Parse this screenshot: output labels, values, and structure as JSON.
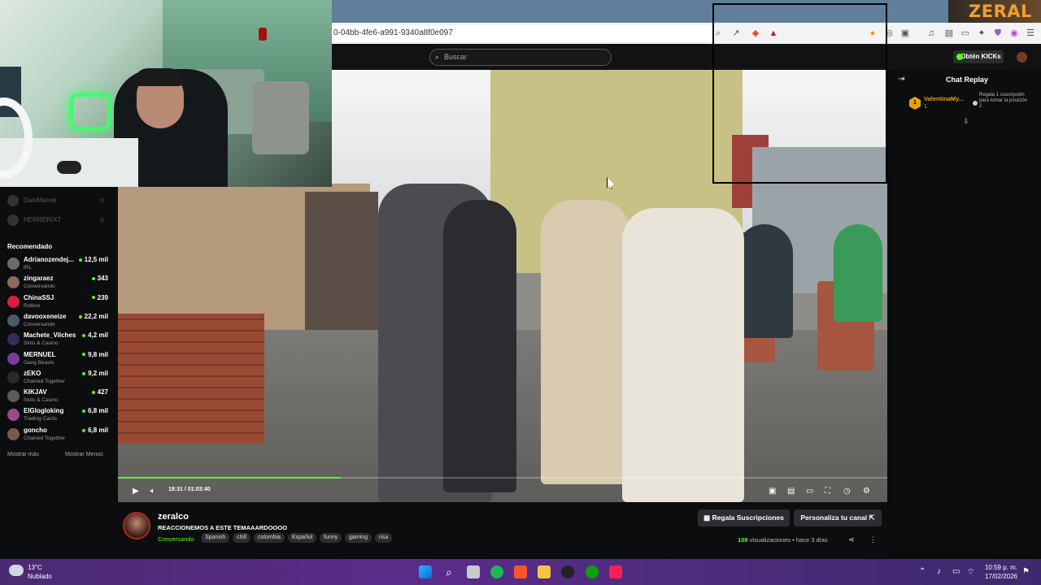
{
  "browser": {
    "url": "0-04bb-4fe6-a991-9340a8f0e097",
    "toolbar_icons": [
      "zoom-icon",
      "share-icon",
      "brave-shield-icon",
      "alert-icon",
      "ext-icon-1",
      "ext-icon-2",
      "ext-icon-3",
      "media-icon",
      "bookmark-icon",
      "tabs-icon",
      "sparkle-icon",
      "vpn-icon",
      "wallet-icon",
      "menu-icon"
    ]
  },
  "overlay": {
    "brand_text": "ZERAL"
  },
  "header": {
    "search_placeholder": "Buscar",
    "kicks_button": "Obtén KICKs"
  },
  "sidebar": {
    "followed": [
      {
        "name": "DaniMarvel"
      },
      {
        "name": "HERRERIX7"
      }
    ],
    "recommended_heading": "Recomendado",
    "recommended": [
      {
        "name": "Adrianozendej...",
        "category": "IRL",
        "viewers": "12,5 mil",
        "color": "#6b6b6b"
      },
      {
        "name": "zingaraez",
        "category": "Conversando",
        "viewers": "343",
        "color": "#8a6a5a"
      },
      {
        "name": "ChinaSSJ",
        "category": "Roblox",
        "viewers": "239",
        "color": "#d8203a"
      },
      {
        "name": "davooxeneize",
        "category": "Conversando",
        "viewers": "22,2 mil",
        "color": "#4a5a6a"
      },
      {
        "name": "Machete_Vilches",
        "category": "Slots & Casino",
        "viewers": "4,2 mil",
        "color": "#3a2a5a"
      },
      {
        "name": "MERNUEL",
        "category": "Gang Beasts",
        "viewers": "9,8 mil",
        "color": "#7a3aa0"
      },
      {
        "name": "zEKO",
        "category": "Chained Together",
        "viewers": "9,2 mil",
        "color": "#2a2a2a"
      },
      {
        "name": "KIKJAV",
        "category": "Slots & Casino",
        "viewers": "427",
        "color": "#5a5a5a"
      },
      {
        "name": "ElGlogloking",
        "category": "Trading Cards",
        "viewers": "6,8 mil",
        "color": "#9a4a8a"
      },
      {
        "name": "goncho",
        "category": "Chained Together",
        "viewers": "6,8 mil",
        "color": "#7a5a4a"
      }
    ],
    "show_more": "Mostrar más",
    "show_less": "Mostrar Menos"
  },
  "player": {
    "time": "18:31 / 01:03:40",
    "progress": 0.29,
    "accent": "#53fc18"
  },
  "chat": {
    "title": "Chat Replay",
    "gift_user": "ValentinaMy...",
    "gift_count": "1",
    "gift_text": "Regala 1 suscripción para tomar la posición 2"
  },
  "stream": {
    "streamer": "zeralco",
    "title": "REACCIONEMOS A ESTE TEMAAARDOOOO",
    "category": "Conversando",
    "tags": [
      "Spanish",
      "chill",
      "colombia",
      "Español",
      "funny",
      "gaming",
      "risa"
    ],
    "gift_subs_button": "Regala Suscripciones",
    "customize_button": "Personaliza tu canal",
    "view_count": "108",
    "views_label": "visualizaciones",
    "ago": "hace 3 días"
  },
  "taskbar": {
    "temp": "13°C",
    "weather": "Nublado",
    "time": "10:59 p. m.",
    "date": "17/02/2026"
  }
}
